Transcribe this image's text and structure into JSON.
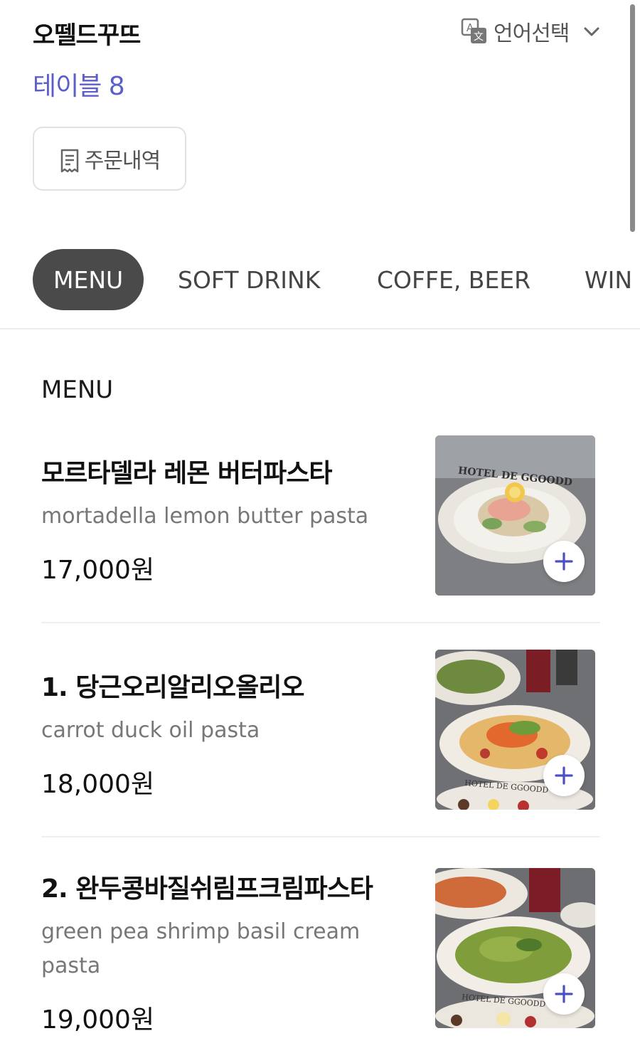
{
  "header": {
    "store_name": "오뗄드꾸뜨",
    "table_label": "테이블 8",
    "language_label": "언어선택",
    "language_icon": "translate-icon",
    "order_history_label": "주문내역",
    "order_history_icon": "receipt-icon"
  },
  "tabs": [
    {
      "label": "MENU",
      "active": true
    },
    {
      "label": "SOFT DRINK",
      "active": false
    },
    {
      "label": "COFFE, BEER",
      "active": false
    },
    {
      "label": "WIN",
      "active": false
    }
  ],
  "section": {
    "title": "MENU"
  },
  "items": [
    {
      "name": "모르타델라 레몬 버터파스타",
      "description": "mortadella lemon butter pasta",
      "price": "17,000원",
      "image_text": "HOTEL DE GGOODD"
    },
    {
      "name": "1. 당근오리알리오올리오",
      "description": "carrot duck oil pasta",
      "price": "18,000원",
      "image_text": "HOTEL DE GGOODD"
    },
    {
      "name": "2. 완두콩바질쉬림프크림파스타",
      "description": "green pea shrimp basil cream pasta",
      "price": "19,000원",
      "image_text": "HOTEL DE GGOODD"
    }
  ],
  "colors": {
    "accent": "#5b5fc7",
    "active_tab_bg": "#4a4a4a",
    "plus_icon": "#4c4fc4"
  }
}
